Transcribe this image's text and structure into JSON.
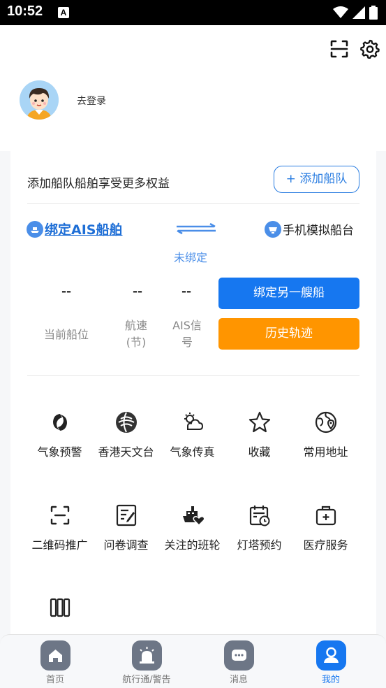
{
  "status_bar": {
    "time": "10:52",
    "notification_letter": "A"
  },
  "header": {
    "scan_icon": "scan-icon",
    "settings_icon": "gear-icon"
  },
  "profile": {
    "login_label": "去登录"
  },
  "fleet": {
    "promo_text": "添加船队船舶享受更多权益",
    "add_fleet_label": "+ 添加船队"
  },
  "binding": {
    "bind_ais_label": "绑定AIS船舶",
    "status": "未绑定",
    "phone_sim_label": "手机模拟船台"
  },
  "stats": [
    {
      "value": "--",
      "label": "当前船位"
    },
    {
      "value": "--",
      "label": "航速\n(节)"
    },
    {
      "value": "--",
      "label": "AIS信\n号"
    }
  ],
  "actions": {
    "bind_another": "绑定另一艘船",
    "history_track": "历史轨迹"
  },
  "grid_items": [
    {
      "label": "气象预警",
      "icon": "typhoon-icon"
    },
    {
      "label": "香港天文台",
      "icon": "observatory-icon"
    },
    {
      "label": "气象传真",
      "icon": "weather-fax-icon"
    },
    {
      "label": "收藏",
      "icon": "star-icon"
    },
    {
      "label": "常用地址",
      "icon": "globe-pin-icon"
    },
    {
      "label": "二维码推广",
      "icon": "qrcode-icon"
    },
    {
      "label": "问卷调查",
      "icon": "survey-icon"
    },
    {
      "label": "关注的班轮",
      "icon": "ship-heart-icon"
    },
    {
      "label": "灯塔预约",
      "icon": "calendar-icon"
    },
    {
      "label": "医疗服务",
      "icon": "medical-kit-icon"
    },
    {
      "label": "",
      "icon": "columns-icon"
    }
  ],
  "bottom_nav": [
    {
      "label": "首页",
      "icon": "home-icon"
    },
    {
      "label": "航行通/警告",
      "icon": "alarm-icon"
    },
    {
      "label": "消息",
      "icon": "message-icon"
    },
    {
      "label": "我的",
      "icon": "user-icon",
      "active": true
    }
  ],
  "colors": {
    "primary": "#1677f0",
    "orange": "#ff9500",
    "link": "#1f6fd6"
  }
}
